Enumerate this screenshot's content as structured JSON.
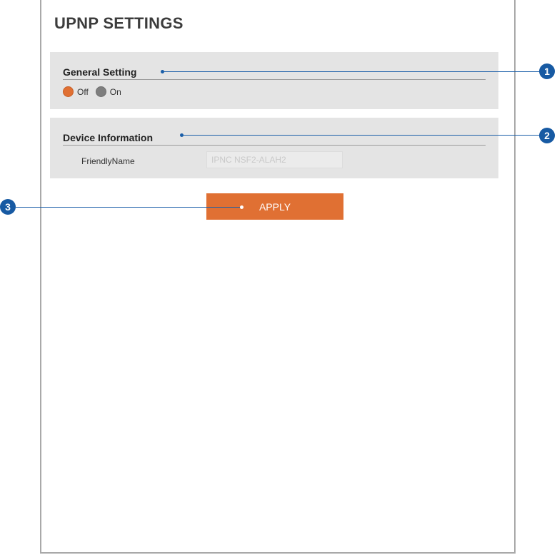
{
  "page": {
    "title": "UPNP SETTINGS"
  },
  "general_setting": {
    "title": "General Setting",
    "options": [
      {
        "label": "Off",
        "selected": true
      },
      {
        "label": "On",
        "selected": false
      }
    ]
  },
  "device_information": {
    "title": "Device Information",
    "friendly_name": {
      "label": "FriendlyName",
      "value": "IPNC NSF2-ALAH2"
    }
  },
  "apply_button": {
    "label": "APPLY"
  },
  "callouts": [
    {
      "number": "1"
    },
    {
      "number": "2"
    },
    {
      "number": "3"
    }
  ],
  "colors": {
    "accent": "#e07033",
    "panel_bg": "#e4e4e4",
    "callout": "#175aa3"
  }
}
